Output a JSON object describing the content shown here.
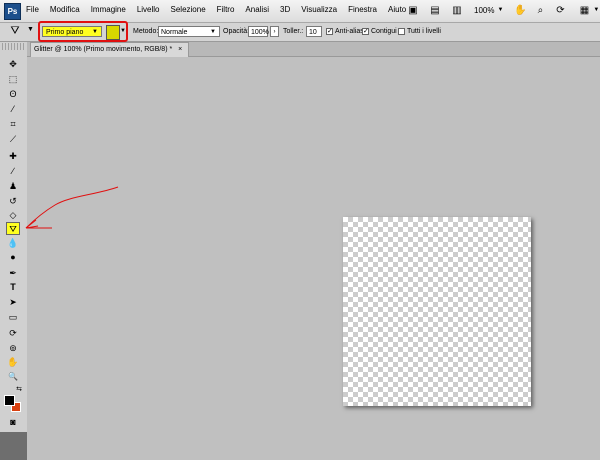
{
  "app": {
    "logo": "Ps"
  },
  "menu": [
    "File",
    "Modifica",
    "Immagine",
    "Livello",
    "Selezione",
    "Filtro",
    "Analisi",
    "3D",
    "Visualizza",
    "Finestra",
    "Aiuto"
  ],
  "menu_right": {
    "zoom": "100%"
  },
  "options": {
    "fill_source": "Primo piano",
    "mode_label": "Metodo:",
    "mode_value": "Normale",
    "opacity_label": "Opacità:",
    "opacity_value": "100%",
    "tolerance_label": "Toller.:",
    "tolerance_value": "10",
    "antialias_label": "Anti-alias",
    "contiguous_label": "Contigui",
    "all_layers_label": "Tutti i livelli",
    "antialias_checked": true,
    "contiguous_checked": true,
    "all_layers_checked": false
  },
  "document": {
    "tab_title": "Glitter @ 100% (Primo movimento, RGB/8) *",
    "close": "×"
  },
  "tools": [
    {
      "name": "move-tool",
      "glyph": "✥"
    },
    {
      "name": "marquee-tool",
      "glyph": "⬚"
    },
    {
      "name": "lasso-tool",
      "glyph": "ʘ"
    },
    {
      "name": "quick-select-tool",
      "glyph": "⁄"
    },
    {
      "name": "crop-tool",
      "glyph": "⌗"
    },
    {
      "name": "eyedropper-tool",
      "glyph": "⟋"
    },
    {
      "name": "healing-brush-tool",
      "glyph": "✚"
    },
    {
      "name": "brush-tool",
      "glyph": "∕"
    },
    {
      "name": "clone-stamp-tool",
      "glyph": "♟"
    },
    {
      "name": "history-brush-tool",
      "glyph": "↺"
    },
    {
      "name": "eraser-tool",
      "glyph": "◇"
    },
    {
      "name": "paint-bucket-tool",
      "glyph": "⛛"
    },
    {
      "name": "blur-tool",
      "glyph": "💧"
    },
    {
      "name": "dodge-tool",
      "glyph": "●"
    },
    {
      "name": "pen-tool",
      "glyph": "✒"
    },
    {
      "name": "type-tool",
      "glyph": "T"
    },
    {
      "name": "path-select-tool",
      "glyph": "➤"
    },
    {
      "name": "shape-tool",
      "glyph": "▭"
    },
    {
      "name": "3d-rotate-tool",
      "glyph": "⟳"
    },
    {
      "name": "3d-orbit-tool",
      "glyph": "⊚"
    },
    {
      "name": "hand-tool",
      "glyph": "✋"
    },
    {
      "name": "zoom-tool",
      "glyph": "🔍"
    },
    {
      "name": "swap-colors",
      "glyph": "⇆"
    }
  ],
  "colors": {
    "foreground": "#000000",
    "background": "#d84010",
    "highlight": "#ffff20",
    "annotation": "#e01010"
  },
  "quick_mask": {
    "glyph": "◙"
  }
}
